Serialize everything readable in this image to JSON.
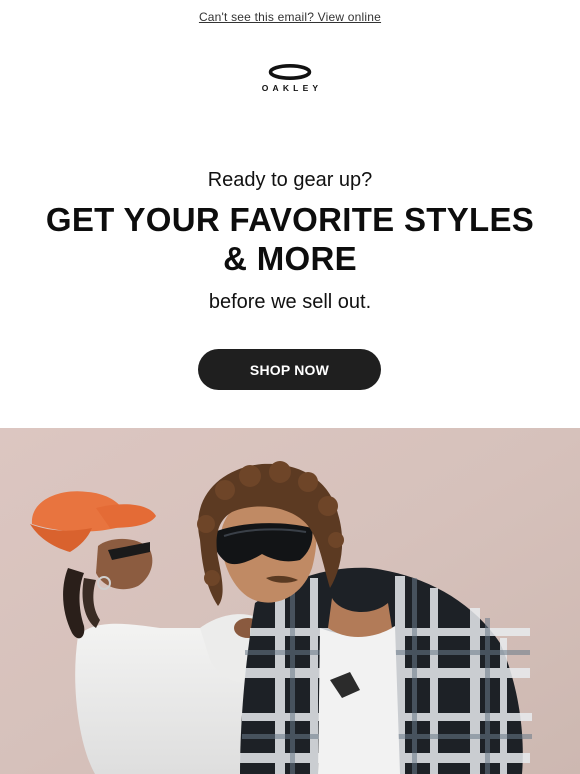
{
  "header": {
    "view_online": "Can't see this email? View online"
  },
  "brand": {
    "logo_text": "OAKLEY"
  },
  "hero_copy": {
    "kicker": "Ready to gear up?",
    "headline": "GET YOUR FAVORITE STYLES & MORE",
    "subline": "before we sell out.",
    "cta_label": "SHOP NOW"
  },
  "colors": {
    "cta_background": "#1f1f1f",
    "cta_text": "#ffffff",
    "background": "#ffffff",
    "text": "#111111"
  }
}
